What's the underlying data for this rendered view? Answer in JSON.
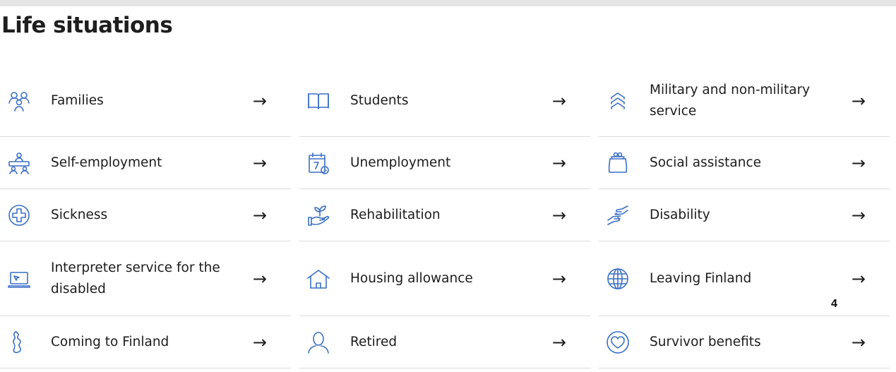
{
  "heading": "Life situations",
  "arrow": "→",
  "badge": "4",
  "colors": {
    "icon": "#3a6fc5",
    "divider": "#dcdcdc",
    "text": "#1c1c1c"
  },
  "tiles": [
    {
      "label": "Families",
      "icon": "family-icon"
    },
    {
      "label": "Students",
      "icon": "book-icon"
    },
    {
      "label": "Military and non-military service",
      "icon": "chevrons-up-icon"
    },
    {
      "label": "Self-employment",
      "icon": "people-at-desk-icon"
    },
    {
      "label": "Unemployment",
      "icon": "calendar-clock-icon"
    },
    {
      "label": "Social assistance",
      "icon": "purse-icon"
    },
    {
      "label": "Sickness",
      "icon": "medical-cross-icon"
    },
    {
      "label": "Rehabilitation",
      "icon": "hand-sprout-icon"
    },
    {
      "label": "Disability",
      "icon": "helping-hands-icon"
    },
    {
      "label": "Interpreter service for the disabled",
      "icon": "laptop-icon"
    },
    {
      "label": "Housing allowance",
      "icon": "house-icon"
    },
    {
      "label": "Leaving Finland",
      "icon": "globe-icon"
    },
    {
      "label": "Coming to Finland",
      "icon": "finland-map-icon"
    },
    {
      "label": "Retired",
      "icon": "person-icon"
    },
    {
      "label": "Survivor benefits",
      "icon": "heart-circle-icon"
    }
  ]
}
